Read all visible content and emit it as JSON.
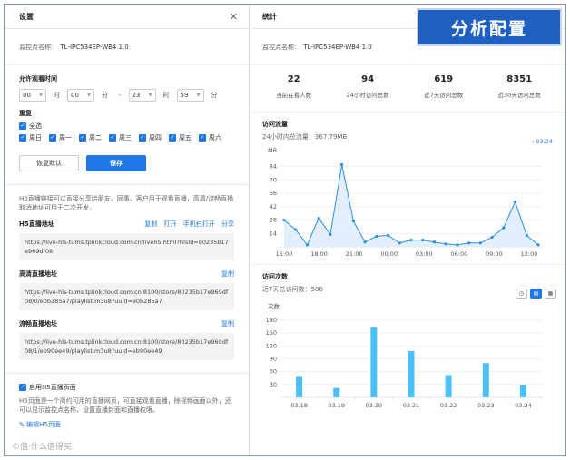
{
  "left": {
    "title": "设置",
    "device_label": "监控点名称:",
    "device_name": "TL-IPC534EP-WB4 1.0",
    "time_section": "允许观看时间",
    "start_h": "00",
    "start_m": "00",
    "end_h": "23",
    "end_m": "59",
    "unit_h": "时",
    "unit_m": "分",
    "dash": "-",
    "repeat_label": "重复",
    "all_label": "全选",
    "days": [
      "周日",
      "周一",
      "周二",
      "周三",
      "周四",
      "周五",
      "周六"
    ],
    "reset_btn": "恢复默认",
    "save_btn": "保存",
    "share_desc": "H5直播链接可以直接分享给朋友、同事、客户用于观看直播，高清/流畅直播取消地址可用于二次开发。",
    "h5_title": "H5直播地址",
    "h5_actions": [
      "复制",
      "打开",
      "手机扫打开",
      "分享"
    ],
    "h5_url": "https://live-hls-tums.tplinkcloud.com.cn/liveh5.html?hlsId=80235b17e969df08",
    "hd_title": "高清直播地址",
    "copy": "复制",
    "hd_url": "https://live-hls-tums.tplinkcloud.com.cn:8100/store/80235b17e969df08/0/e0b285a7/playlist.m3u8?uuid=e0b285a7",
    "sd_title": "流畅直播地址",
    "sd_url": "https://live-hls-tums.tplinkcloud.com.cn:8100/store/80235b17e969df08/1/eb90ee49/playlist.m3u8?uuid=eb90ee49",
    "enable_label": "启用H5直播页面",
    "enable_desc": "H5页面是一个简约可用的直播网页，可直接观看直播，除视频画面以外，还可以显示监控点名称、设置直播封面和直播权限。",
    "edit_link": "编辑H5页面"
  },
  "right": {
    "title": "统计",
    "banner": "分析配置",
    "device_label": "监控点名称:",
    "device_name": "TL-IPC534EP-WB4 1.0",
    "stats": [
      {
        "n": "22",
        "l": "当前在看人数"
      },
      {
        "n": "94",
        "l": "24小时访问总数"
      },
      {
        "n": "619",
        "l": "近7天访问总数"
      },
      {
        "n": "8351",
        "l": "近30天访问总数"
      }
    ],
    "traffic_title": "访问流量",
    "traffic_sub": "24小时内总流量：367.79MB",
    "date_nav": "03.24",
    "visits_title": "访问次数",
    "visits_sub": "近7天总访问数：506"
  },
  "chart_data": [
    {
      "type": "area",
      "ylabel": "MB",
      "yticks": [
        14,
        28,
        42,
        56,
        70,
        84
      ],
      "ylim": [
        0,
        95
      ],
      "xticks": [
        "15:00",
        "18:00",
        "21:00",
        "00:00",
        "03:00",
        "06:00",
        "09:00",
        "12:00"
      ],
      "values": [
        28,
        18,
        2,
        30,
        13,
        86,
        27,
        5,
        11,
        12,
        4,
        7,
        7,
        5,
        3,
        2,
        4,
        4,
        10,
        20,
        47,
        12,
        2
      ]
    },
    {
      "type": "bar",
      "ylabel": "次数",
      "categories": [
        "03.18",
        "03.19",
        "03.20",
        "03.21",
        "03.22",
        "03.23",
        "03.24"
      ],
      "values": [
        50,
        22,
        165,
        108,
        52,
        80,
        30
      ],
      "yticks": [
        30,
        60,
        90,
        120,
        150,
        180
      ],
      "ylim": [
        0,
        195
      ]
    }
  ],
  "watermark": "©值·什么值得买"
}
